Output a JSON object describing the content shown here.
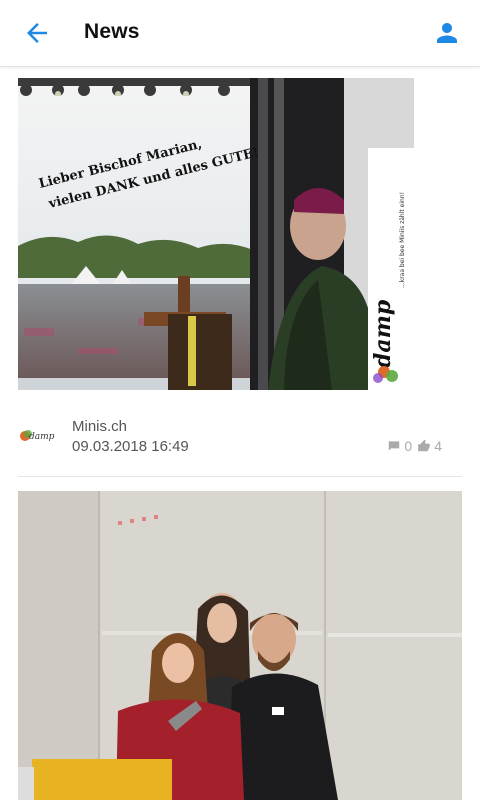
{
  "header": {
    "title": "News",
    "back_icon": "arrow-left-icon",
    "profile_icon": "person-icon",
    "accent": "#1e88e5"
  },
  "posts": [
    {
      "image_text": {
        "line1": "Lieber Bischof Marian,",
        "line2": "vielen DANK und alles GUTE!",
        "side_text": "...kraa bei bee Miniis zählt einn!",
        "logo_text": "damp"
      },
      "source": "Minis.ch",
      "date": "09.03.2018 16:49",
      "comments": "0",
      "likes": "4"
    },
    {
      "image_text": {}
    }
  ]
}
